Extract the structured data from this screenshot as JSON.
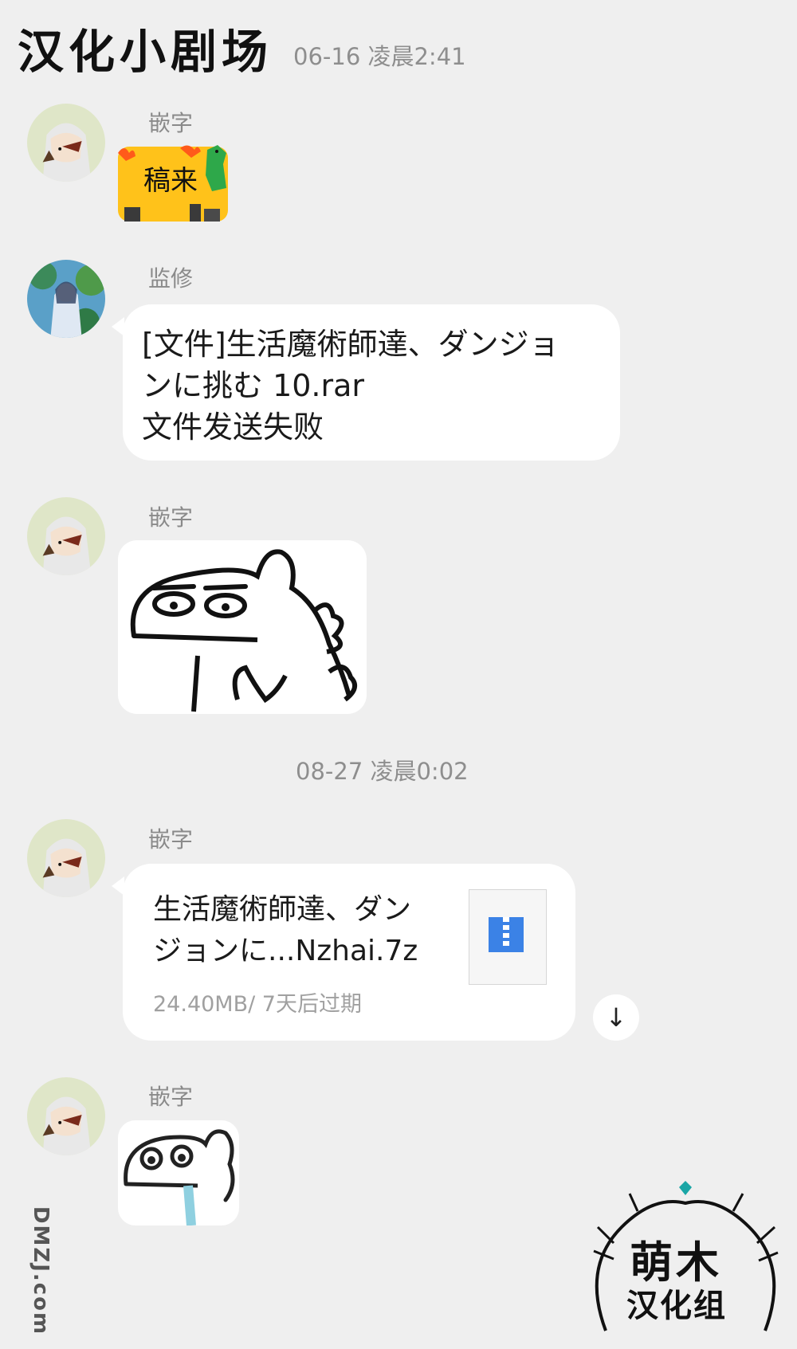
{
  "chat": {
    "title": "汉化小剧场",
    "timestamp1": "06-16 凌晨2:41",
    "timestamp2": "08-27 凌晨0:02"
  },
  "messages": [
    {
      "sender": "嵌字",
      "type": "sticker",
      "sticker_text": "稿来"
    },
    {
      "sender": "监修",
      "type": "text",
      "lines": [
        "[文件]生活魔術師達、ダンジョ",
        "ンに挑む 10.rar",
        "文件发送失败"
      ]
    },
    {
      "sender": "嵌字",
      "type": "sticker"
    },
    {
      "sender": "嵌字",
      "type": "file",
      "file_lines": [
        "生活魔術師達、ダン",
        "ジョンに...Nzhai.7z"
      ],
      "file_meta": "24.40MB/ 7天后过期",
      "download_glyph": "↓"
    },
    {
      "sender": "嵌字",
      "type": "sticker"
    }
  ],
  "watermark": {
    "side_text": "DMZJ.com",
    "logo_line1": "萌木",
    "logo_line2": "汉化组"
  },
  "colors": {
    "background": "#efefef",
    "bubble": "#ffffff",
    "sticker_yellow": "#ffc21a",
    "zip_blue": "#3b82e6",
    "logo_teal": "#1aa6a6"
  },
  "icons": {
    "zip_file": "zip-file-icon",
    "download": "download-arrow-icon"
  }
}
